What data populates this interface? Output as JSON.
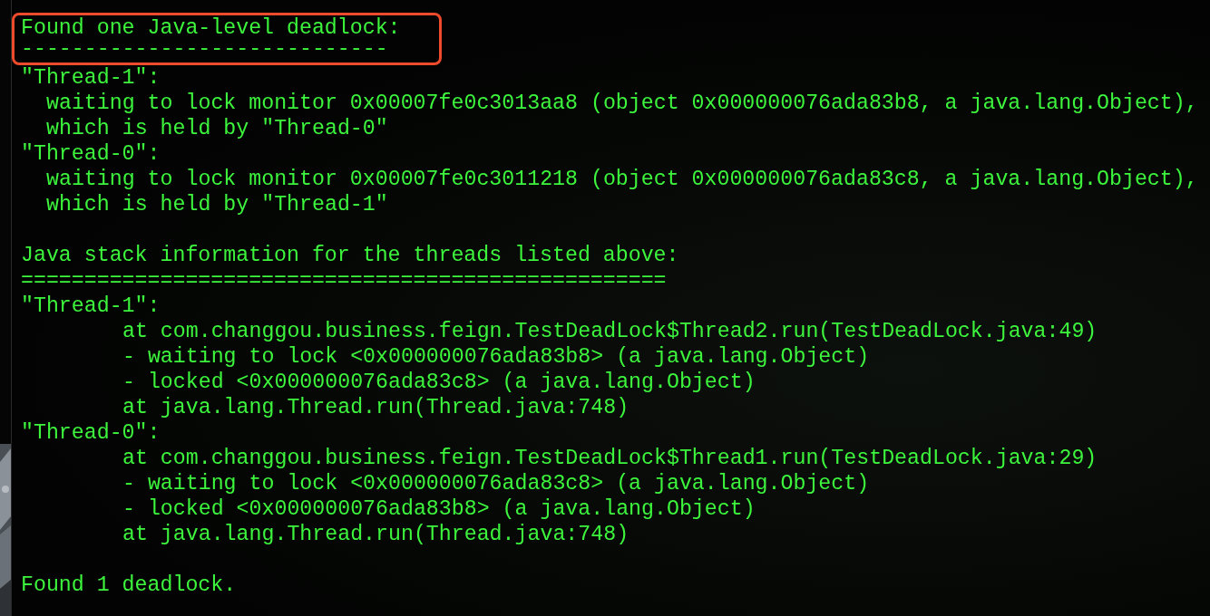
{
  "highlighted_block": {
    "highlighted": true,
    "lines": [
      {
        "kind": "header",
        "text": "Found one Java-level deadlock:"
      },
      {
        "kind": "header",
        "text": "-----------------------------"
      }
    ]
  },
  "lines": [
    {
      "kind": "header",
      "text": "\"Thread-1\":"
    },
    {
      "kind": "detail",
      "text": "waiting to lock monitor 0x00007fe0c3013aa8 (object 0x000000076ada83b8, a java.lang.Object),"
    },
    {
      "kind": "detail",
      "text": "which is held by \"Thread-0\""
    },
    {
      "kind": "header",
      "text": "\"Thread-0\":"
    },
    {
      "kind": "detail",
      "text": "waiting to lock monitor 0x00007fe0c3011218 (object 0x000000076ada83c8, a java.lang.Object),"
    },
    {
      "kind": "detail",
      "text": "which is held by \"Thread-1\""
    },
    {
      "kind": "blank"
    },
    {
      "kind": "header",
      "text": "Java stack information for the threads listed above:"
    },
    {
      "kind": "header",
      "text": "==================================================="
    },
    {
      "kind": "header",
      "text": "\"Thread-1\":"
    },
    {
      "kind": "frame",
      "text": "at com.changgou.business.feign.TestDeadLock$Thread2.run(TestDeadLock.java:49)"
    },
    {
      "kind": "frame",
      "text": "- waiting to lock <0x000000076ada83b8> (a java.lang.Object)"
    },
    {
      "kind": "frame",
      "text": "- locked <0x000000076ada83c8> (a java.lang.Object)"
    },
    {
      "kind": "frame",
      "text": "at java.lang.Thread.run(Thread.java:748)"
    },
    {
      "kind": "header",
      "text": "\"Thread-0\":"
    },
    {
      "kind": "frame",
      "text": "at com.changgou.business.feign.TestDeadLock$Thread1.run(TestDeadLock.java:29)"
    },
    {
      "kind": "frame",
      "text": "- waiting to lock <0x000000076ada83c8> (a java.lang.Object)"
    },
    {
      "kind": "frame",
      "text": "- locked <0x000000076ada83b8> (a java.lang.Object)"
    },
    {
      "kind": "frame",
      "text": "at java.lang.Thread.run(Thread.java:748)"
    },
    {
      "kind": "blank"
    },
    {
      "kind": "header",
      "text": "Found 1 deadlock."
    }
  ]
}
